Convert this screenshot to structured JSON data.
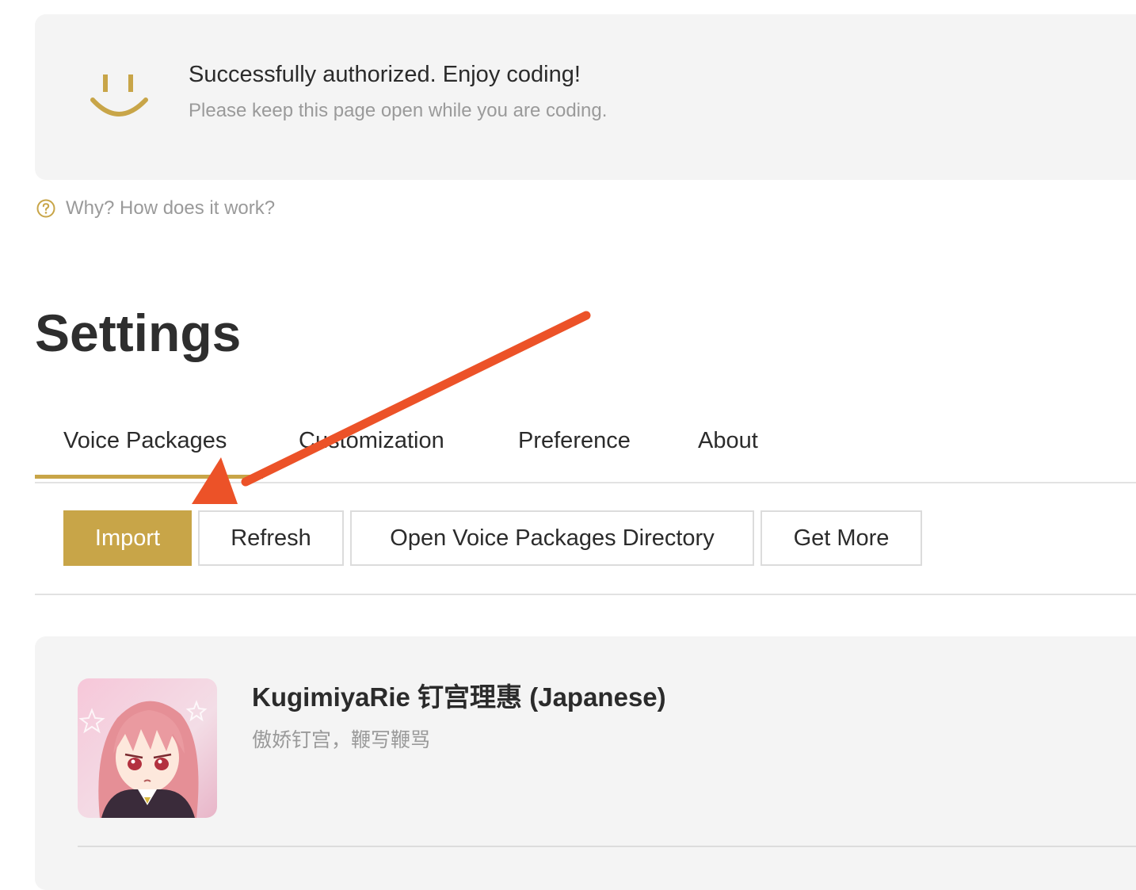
{
  "auth": {
    "title": "Successfully authorized. Enjoy coding!",
    "subtitle": "Please keep this page open while you are coding.",
    "icon": "smile-icon"
  },
  "help": {
    "label": "Why? How does it work?",
    "icon": "question-circle-icon"
  },
  "page_title": "Settings",
  "tabs": [
    {
      "label": "Voice Packages",
      "active": true
    },
    {
      "label": "Customization",
      "active": false
    },
    {
      "label": "Preference",
      "active": false
    },
    {
      "label": "About",
      "active": false
    }
  ],
  "toolbar": {
    "import_label": "Import",
    "refresh_label": "Refresh",
    "open_dir_label": "Open Voice Packages Directory",
    "get_more_label": "Get More"
  },
  "packages": [
    {
      "title": "KugimiyaRie 钉宫理惠 (Japanese)",
      "description": "傲娇钉宫，鞭写鞭骂"
    }
  ],
  "colors": {
    "accent": "#c8a548",
    "annotation_arrow": "#ec5228",
    "card_bg": "#f4f4f4"
  }
}
